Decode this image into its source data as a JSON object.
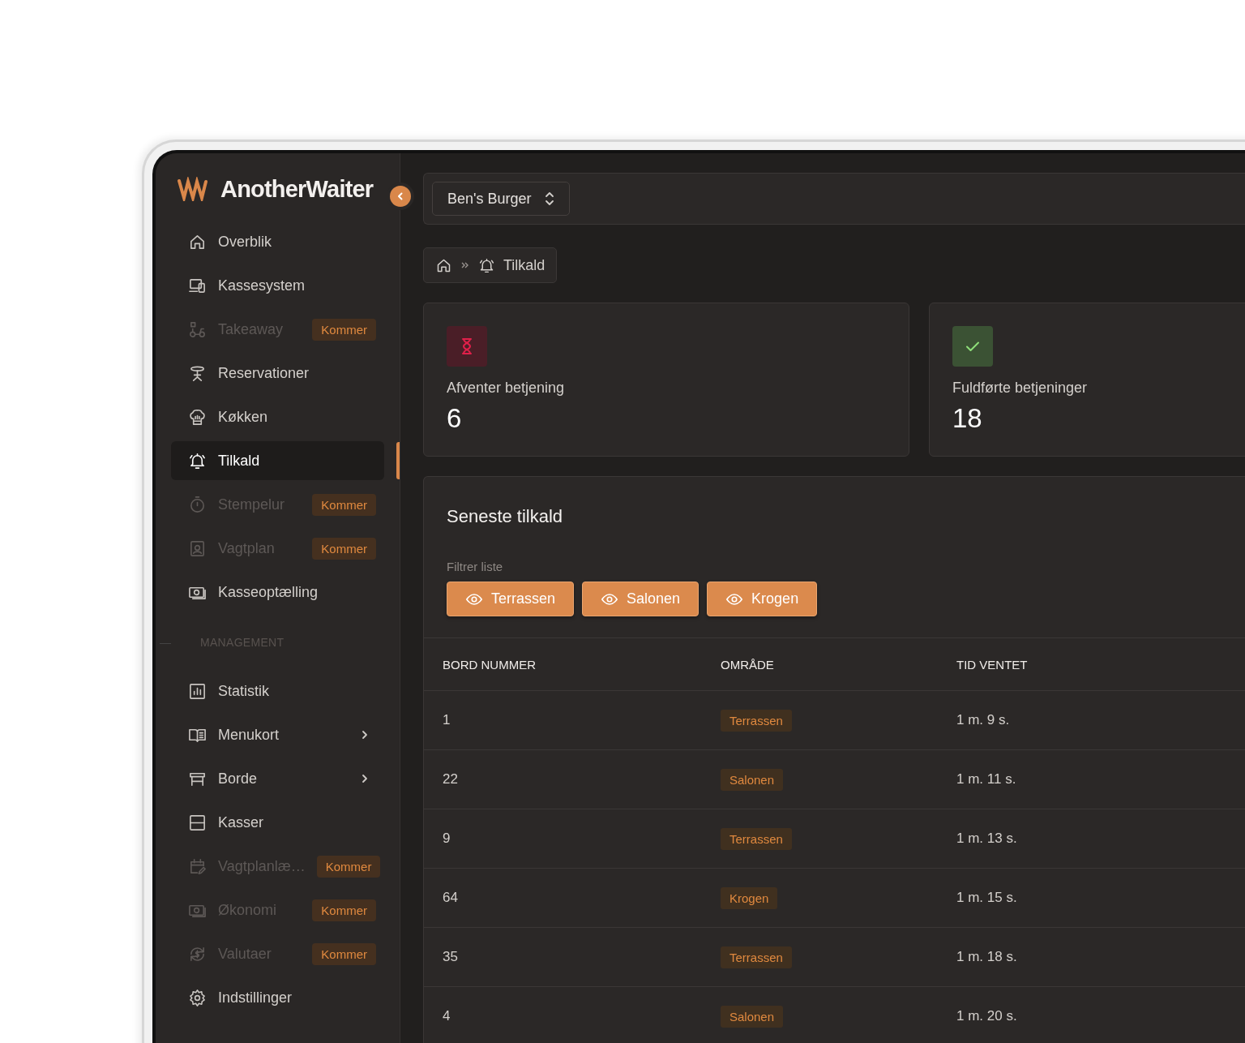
{
  "sidebar": {
    "logo": "AnotherWaiter",
    "items": [
      {
        "label": "Overblik",
        "selected": false,
        "disabled": false,
        "has_submenu": false
      },
      {
        "label": "Kassesystem",
        "selected": false,
        "disabled": false,
        "has_submenu": false
      },
      {
        "label": "Takeaway",
        "selected": false,
        "disabled": true,
        "has_submenu": false,
        "badge": "Kommer"
      },
      {
        "label": "Reservationer",
        "selected": false,
        "disabled": false,
        "has_submenu": false
      },
      {
        "label": "Køkken",
        "selected": false,
        "disabled": false,
        "has_submenu": false
      },
      {
        "label": "Tilkald",
        "selected": true,
        "disabled": false,
        "has_submenu": false
      },
      {
        "label": "Stempelur",
        "selected": false,
        "disabled": true,
        "has_submenu": false,
        "badge": "Kommer"
      },
      {
        "label": "Vagtplan",
        "selected": false,
        "disabled": true,
        "has_submenu": false,
        "badge": "Kommer"
      },
      {
        "label": "Kasseoptælling",
        "selected": false,
        "disabled": false,
        "has_submenu": false
      }
    ],
    "section_title": "MANAGEMENT",
    "section_items": [
      {
        "label": "Statistik",
        "selected": false,
        "disabled": false,
        "has_submenu": false
      },
      {
        "label": "Menukort",
        "selected": false,
        "disabled": false,
        "has_submenu": true
      },
      {
        "label": "Borde",
        "selected": false,
        "disabled": false,
        "has_submenu": true
      },
      {
        "label": "Kasser",
        "selected": false,
        "disabled": false,
        "has_submenu": false
      },
      {
        "label": "Vagtplanlæ…",
        "selected": false,
        "disabled": true,
        "has_submenu": false,
        "badge": "Kommer"
      },
      {
        "label": "Økonomi",
        "selected": false,
        "disabled": true,
        "has_submenu": false,
        "badge": "Kommer"
      },
      {
        "label": "Valutaer",
        "selected": false,
        "disabled": true,
        "has_submenu": false,
        "badge": "Kommer"
      },
      {
        "label": "Indstillinger",
        "selected": false,
        "disabled": false,
        "has_submenu": false
      }
    ]
  },
  "topbar": {
    "restaurant_select": "Ben's Burger"
  },
  "breadcrumb": {
    "current": "Tilkald"
  },
  "stats": [
    {
      "kind": "pending",
      "label": "Afventer betjening",
      "value": "6"
    },
    {
      "kind": "done",
      "label": "Fuldførte betjeninger",
      "value": "18"
    }
  ],
  "calls": {
    "title": "Seneste tilkald",
    "filter_label": "Filtrer liste",
    "filters": [
      "Terrassen",
      "Salonen",
      "Krogen"
    ],
    "columns": [
      "BORD NUMMER",
      "OMRÅDE",
      "TID VENTET"
    ],
    "rows": [
      {
        "table": "1",
        "area": "Terrassen",
        "waited": "1 m. 9 s."
      },
      {
        "table": "22",
        "area": "Salonen",
        "waited": "1 m. 11 s."
      },
      {
        "table": "9",
        "area": "Terrassen",
        "waited": "1 m. 13 s."
      },
      {
        "table": "64",
        "area": "Krogen",
        "waited": "1 m. 15 s."
      },
      {
        "table": "35",
        "area": "Terrassen",
        "waited": "1 m. 18 s."
      },
      {
        "table": "4",
        "area": "Salonen",
        "waited": "1 m. 20 s."
      }
    ]
  }
}
